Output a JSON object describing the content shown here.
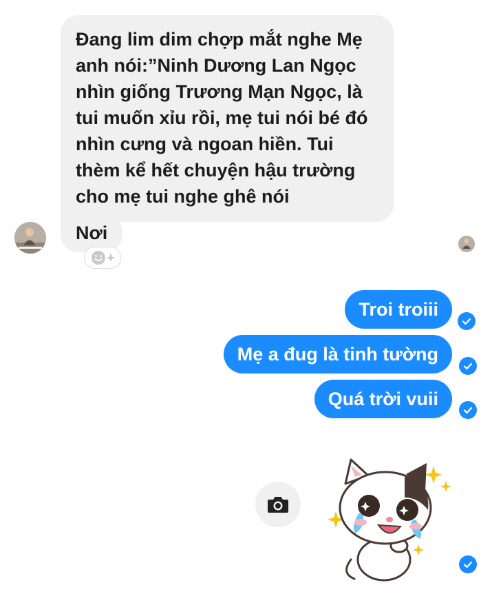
{
  "incoming": {
    "long_message": "Đang lim dim chợp mắt nghe Mẹ anh nói:”Ninh Dương Lan Ngọc nhìn giống Trương Mạn Ngọc, là tui muốn xỉu rồi, mẹ tui nói bé đó nhìn cưng và ngoan hiền. Tui thèm kể hết chuyện hậu trường cho mẹ tui nghe ghê nói",
    "short_message": "Nơi",
    "reaction_button": "+"
  },
  "outgoing": [
    {
      "text": "Troi troiii"
    },
    {
      "text": "Mẹ a đug là tinh tường"
    },
    {
      "text": "Quá trời vuii"
    }
  ],
  "icons": {
    "camera": "camera-icon",
    "check": "check-icon",
    "sticker": "crying-cat-sticker"
  },
  "colors": {
    "accent": "#1a8cff",
    "incoming_bubble": "#f0f0f0"
  }
}
